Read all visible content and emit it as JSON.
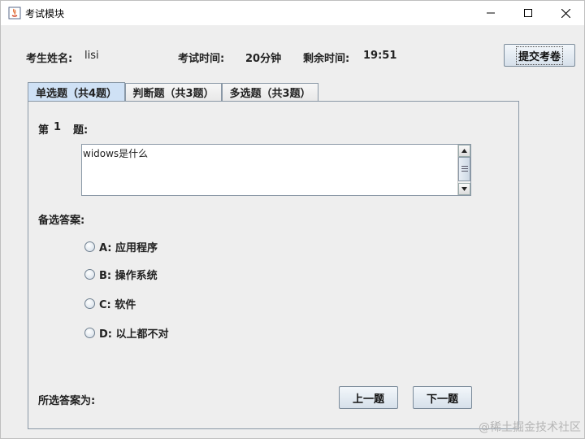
{
  "window": {
    "title": "考试模块",
    "controls": {
      "minimize": "minimize",
      "maximize": "maximize",
      "close": "close"
    }
  },
  "header": {
    "student_label": "考生姓名:",
    "student_name": "lisi",
    "time_label": "考试时间:",
    "time_value": "20分钟",
    "remaining_label": "剩余时间:",
    "remaining_value": "19:51",
    "submit_label": "提交考卷"
  },
  "tabs": [
    {
      "label": "单选题（共4题）",
      "active": true
    },
    {
      "label": "判断题（共3题）",
      "active": false
    },
    {
      "label": "多选题（共3题）",
      "active": false
    }
  ],
  "question": {
    "prefix": "第",
    "number": "1",
    "suffix": "题:",
    "text": "widows是什么"
  },
  "options_label": "备选答案:",
  "options": [
    {
      "label": "A: 应用程序"
    },
    {
      "label": "B: 操作系统"
    },
    {
      "label": "C: 软件"
    },
    {
      "label": "D: 以上都不对"
    }
  ],
  "footer": {
    "selected_label": "所选答案为:",
    "prev_label": "上一题",
    "next_label": "下一题"
  },
  "watermark": "@稀土掘金技术社区",
  "colors": {
    "tab_active": "#cfe1f5",
    "button_border": "#7a8a99",
    "panel_border": "#8a98a6"
  }
}
